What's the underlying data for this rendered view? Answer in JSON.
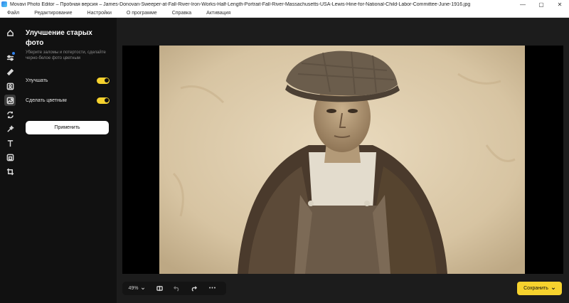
{
  "window": {
    "title": "Movavi Photo Editor – Пробная версия – James-Donovan-Sweeper-at-Fall-River-Iron-Works-Half-Length-Portrait-Fall-River-Massachusetts-USA-Lewis-Hine-for-National-Child-Labor-Committee-June-1916.jpg",
    "minimize": "—",
    "maximize": "▢",
    "close": "✕"
  },
  "menu": [
    "Файл",
    "Редактирование",
    "Настройки",
    "О программе",
    "Справка",
    "Активация"
  ],
  "tools": [
    "home-icon",
    "sliders-icon",
    "eraser-icon",
    "portrait-icon",
    "photo-restore-icon",
    "replace-icon",
    "magic-wand-icon",
    "text-icon",
    "frame-icon",
    "crop-icon"
  ],
  "panel": {
    "title": "Улучшение старых фото",
    "description": "Уберите заломы и потертости, сделайте черно-белое фото цветным",
    "options": [
      {
        "label": "Улучшать",
        "on": true
      },
      {
        "label": "Сделать цветным",
        "on": true
      }
    ],
    "apply_label": "Применить"
  },
  "bottombar": {
    "zoom": "49%",
    "more": "•••"
  },
  "save_label": "Сохранить",
  "colors": {
    "accent": "#f6d22e",
    "sidebar": "#111111",
    "workspace": "#1c1c1c"
  }
}
